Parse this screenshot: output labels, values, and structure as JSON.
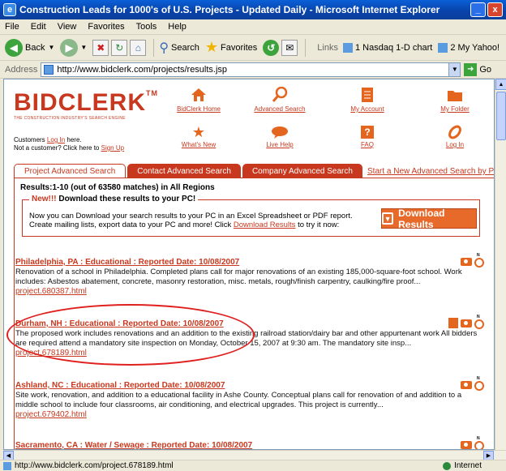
{
  "window": {
    "title": "Construction Leads for 1000's of U.S. Projects - Updated Daily - Microsoft Internet Explorer",
    "min": "_",
    "max": "□",
    "close": "x"
  },
  "menu": [
    "File",
    "Edit",
    "View",
    "Favorites",
    "Tools",
    "Help"
  ],
  "toolbar": {
    "back": "Back",
    "search": "Search",
    "favorites": "Favorites",
    "links_label": "Links",
    "link1": "1 Nasdaq 1-D chart",
    "link2": "2 My Yahoo!"
  },
  "address": {
    "label": "Address",
    "url": "http://www.bidclerk.com/projects/results.jsp",
    "go": "Go"
  },
  "page": {
    "logo": "BIDCLERK",
    "logo_tm": "TM",
    "logo_tagline": "THE CONSTRUCTION INDUSTRY'S SEARCH ENGINE",
    "customers_text": "Customers",
    "login_here": "Log In",
    "here_text": "here.",
    "not_customer": "Not a customer? Click here to",
    "sign_up": "Sign Up",
    "nav": {
      "home": "BidClerk Home",
      "advanced": "Advanced Search",
      "account": "My Account",
      "folder": "My Folder",
      "whats_new": "What's New",
      "live_help": "Live Help",
      "faq": "FAQ",
      "login": "Log In"
    },
    "tabs": [
      "Project Advanced Search",
      "Contact Advanced Search",
      "Company Advanced Search"
    ],
    "start_new": "Start a New Advanced Search by Project",
    "results_header": "Results:1-10 (out of 63580 matches) in All Regions",
    "download": {
      "new": "New!!!",
      "heading": "Download these results to your PC!",
      "line1": "Now you can Download your search results to your PC in an Excel Spreadsheet or PDF report.",
      "line2a": "Create mailing lists, export data to your PC and more!  Click",
      "line2link": "Download Results",
      "line2b": "to try it now:",
      "button": "Download Results"
    },
    "results": [
      {
        "title": "Philadelphia, PA : Educational : Reported Date:  10/08/2007",
        "desc": "Renovation of a school in Philadelphia. Completed plans call for major renovations of an existing 185,000-square-foot school. Work includes: Asbestos abatement, concrete, masonry restoration, misc. metals, rough/finish carpentry, caulking/fire proof...",
        "link": "project.680387.html"
      },
      {
        "title": "Durham, NH : Educational : Reported Date:  10/08/2007",
        "desc": "The proposed work includes renovations and an addition to the existing railroad station/dairy bar and other appurtenant work All bidders are required attend a mandatory site inspection on Monday, October 15, 2007 at 9:30 am. The mandatory site insp...",
        "link": "project.678189.html"
      },
      {
        "title": "Ashland, NC : Educational : Reported Date:  10/08/2007",
        "desc": "Site work, renovation, and addition to a educational facility in Ashe County. Conceptual plans call for renovation of and addition to a middle school to include four classrooms, air conditioning, and electrical upgrades. This project is currently...",
        "link": "project.679402.html"
      },
      {
        "title": "Sacramento, CA : Water / Sewage : Reported Date:  10/08/2007",
        "desc": "",
        "link": ""
      }
    ],
    "compass_n": "N"
  },
  "status": {
    "url": "http://www.bidclerk.com/project.678189.html",
    "zone": "Internet"
  }
}
